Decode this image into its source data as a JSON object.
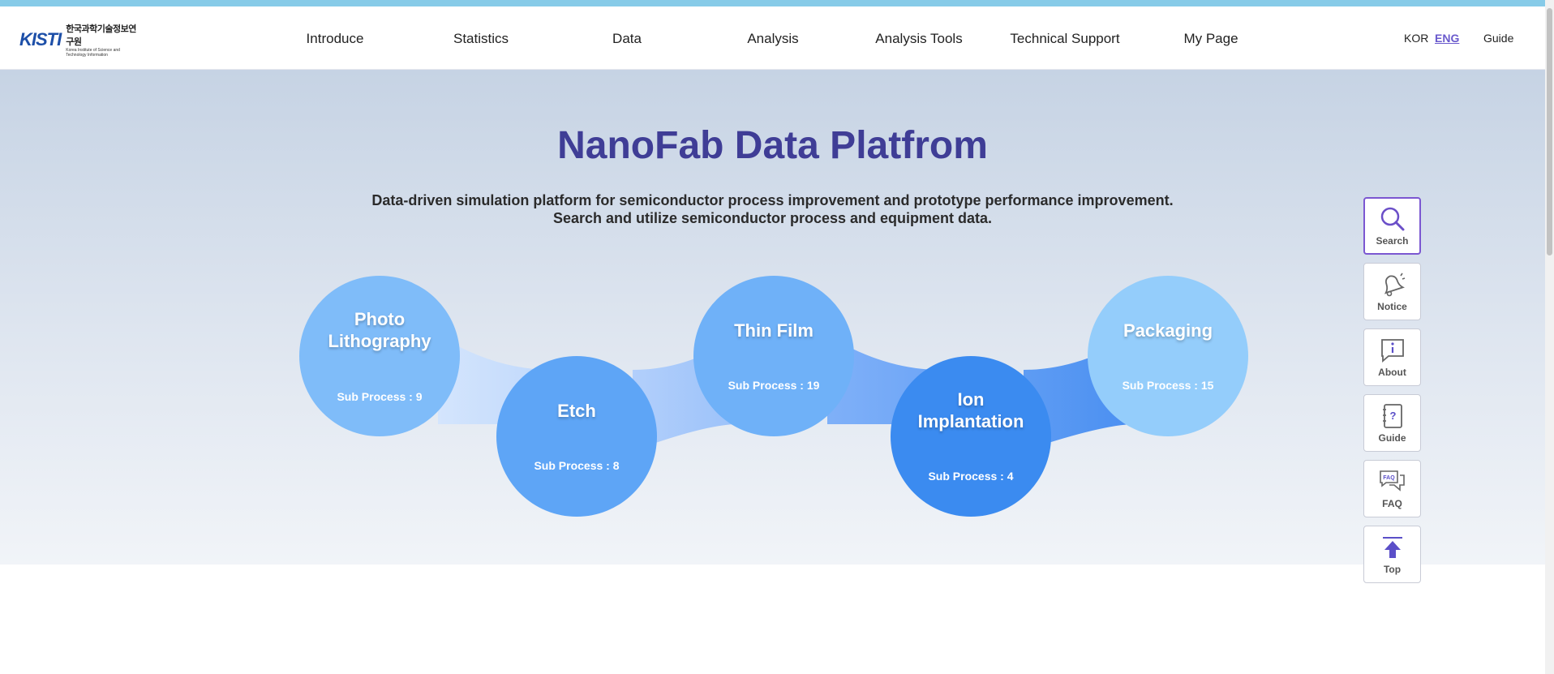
{
  "header": {
    "logo_mark": "KISTI",
    "logo_korean": "한국과학기술정보연구원",
    "logo_english": "Korea Institute of Science and Technology Information",
    "nav": [
      "Introduce",
      "Statistics",
      "Data",
      "Analysis",
      "Analysis Tools",
      "Technical Support",
      "My Page"
    ],
    "lang_kor": "KOR",
    "lang_eng": "ENG",
    "guide": "Guide"
  },
  "hero": {
    "title": "NanoFab Data Platfrom",
    "desc_line1": "Data-driven simulation platform for semiconductor process improvement and prototype performance improvement.",
    "desc_line2": "Search and utilize semiconductor process and equipment data."
  },
  "processes": [
    {
      "title_lines": [
        "Photo",
        "Lithography"
      ],
      "sub": "Sub Process : 9",
      "color": "#7fbcf9"
    },
    {
      "title_lines": [
        "Etch"
      ],
      "sub": "Sub Process : 8",
      "color": "#5ea5f6"
    },
    {
      "title_lines": [
        "Thin Film"
      ],
      "sub": "Sub Process : 19",
      "color": "#6fb1f8"
    },
    {
      "title_lines": [
        "Ion",
        "Implantation"
      ],
      "sub": "Sub Process : 4",
      "color": "#3b8bf0"
    },
    {
      "title_lines": [
        "Packaging"
      ],
      "sub": "Sub Process : 15",
      "color": "#94cdfb"
    }
  ],
  "quick_menu": [
    {
      "label": "Search",
      "icon": "search-icon"
    },
    {
      "label": "Notice",
      "icon": "bell-icon"
    },
    {
      "label": "About",
      "icon": "info-icon"
    },
    {
      "label": "Guide",
      "icon": "question-book-icon"
    },
    {
      "label": "FAQ",
      "icon": "faq-chat-icon"
    },
    {
      "label": "Top",
      "icon": "arrow-up-icon"
    }
  ],
  "colors": {
    "accent": "#3f3d96",
    "active_border": "#7b57d1",
    "top_strip": "#87cbe8"
  }
}
